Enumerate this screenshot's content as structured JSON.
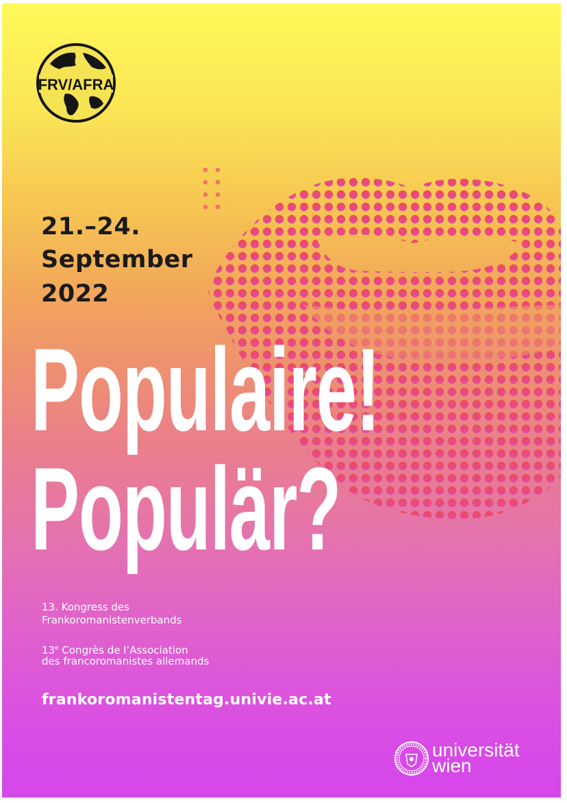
{
  "colors": {
    "top": "#fff95a",
    "middle": "#ee9070",
    "bottom": "#d547ea",
    "lips": "#e8475c",
    "text_dark": "#1a1a1a",
    "text_light": "#ffffff"
  },
  "logo": {
    "text": "FRV/AFRA",
    "icon": "globe-icon"
  },
  "dates": {
    "line1": "21.–24.",
    "line2": "September",
    "line3": "2022"
  },
  "title": {
    "line1": "Populaire!",
    "line2": "Populär?"
  },
  "congress": {
    "de_line1": "13. Kongress des",
    "de_line2": "Frankoromanistenverbands",
    "fr_number": "13",
    "fr_superscript": "e",
    "fr_line1_rest": " Congrès de l’Association",
    "fr_line2": "des francoromanistes allemands"
  },
  "website": "frankoromanistentag.univie.ac.at",
  "university": {
    "line1": "universität",
    "line2": "wien",
    "seal_icon": "university-seal-icon"
  },
  "illustration": {
    "icon": "halftone-lips-icon"
  }
}
